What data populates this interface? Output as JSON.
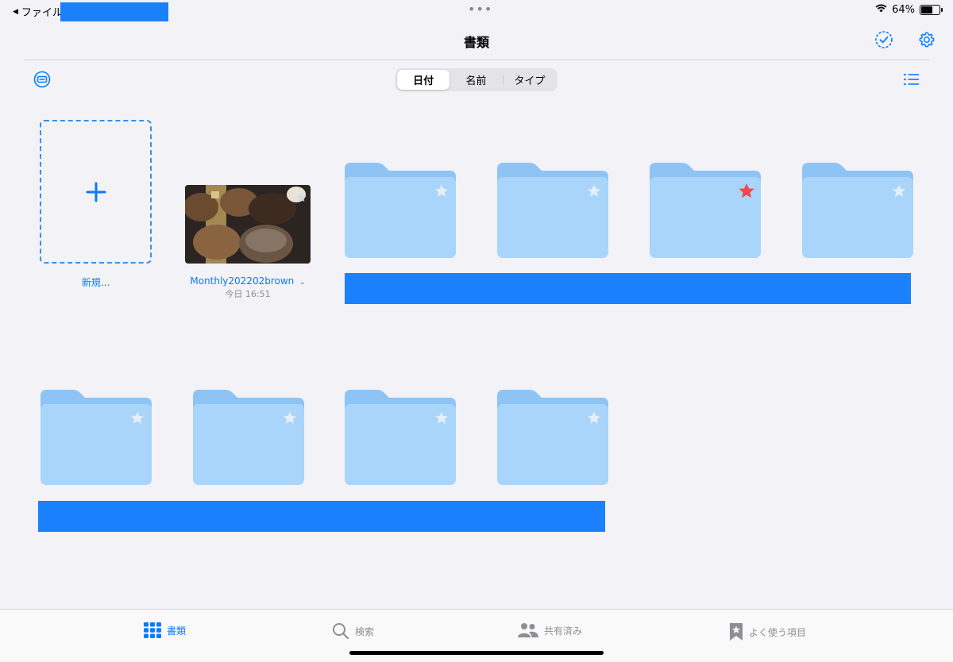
{
  "status": {
    "back_label": "ファイル",
    "battery": "64%",
    "battery_level": 0.64
  },
  "header": {
    "title": "書類"
  },
  "sort": {
    "options": [
      "日付",
      "名前",
      "タイプ"
    ],
    "selected": "日付"
  },
  "new_item": {
    "label": "新規..."
  },
  "document": {
    "name": "Monthly202202brown",
    "date": "今日 16:51",
    "thumbnail_icon": "bread-photo"
  },
  "folders_row1": [
    {
      "starred": false
    },
    {
      "starred": false
    },
    {
      "starred": true
    },
    {
      "starred": false
    }
  ],
  "folders_row2": [
    {
      "starred": false
    },
    {
      "starred": false
    },
    {
      "starred": false
    },
    {
      "starred": false
    }
  ],
  "tabs": [
    {
      "label": "書類",
      "icon": "grid-icon",
      "active": true
    },
    {
      "label": "検索",
      "icon": "search-icon",
      "active": false
    },
    {
      "label": "共有済み",
      "icon": "people-icon",
      "active": false
    },
    {
      "label": "よく使う項目",
      "icon": "bookmark-star-icon",
      "active": false
    }
  ],
  "colors": {
    "accent": "#0a7aff",
    "folder": "#a9d5fb",
    "folder_tab": "#8ec4f5",
    "star_on": "#f2474d",
    "redaction": "#1a80fb"
  }
}
